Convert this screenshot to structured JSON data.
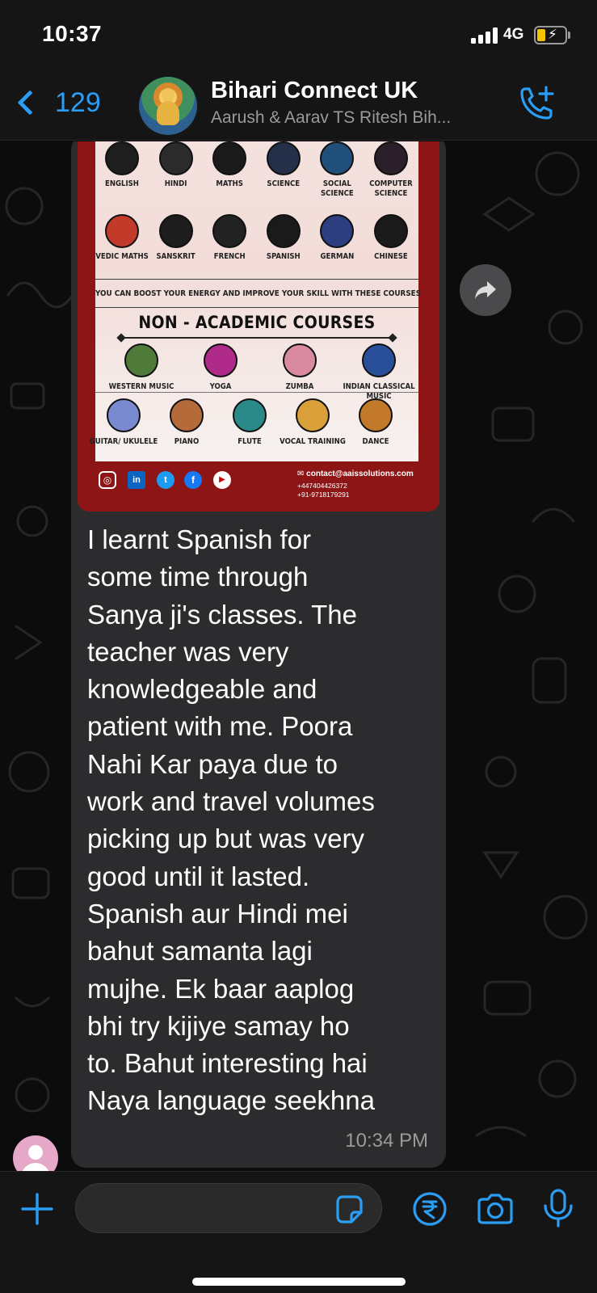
{
  "status_bar": {
    "time": "10:37",
    "network": "4G",
    "battery_color": "#f5c400"
  },
  "header": {
    "back_count": "129",
    "title": "Bihari Connect UK",
    "subtitle": "Aarush & Aarav TS Ritesh Bih..."
  },
  "poster": {
    "academic_courses": [
      "ENGLISH",
      "HINDI",
      "MATHS",
      "SCIENCE",
      "SOCIAL SCIENCE",
      "COMPUTER SCIENCE",
      "VEDIC MATHS",
      "SANSKRIT",
      "FRENCH",
      "SPANISH",
      "GERMAN",
      "CHINESE"
    ],
    "boost_text": "YOU CAN BOOST YOUR ENERGY AND IMPROVE YOUR SKILL WITH THESE COURSES",
    "non_academic_title": "NON - ACADEMIC COURSES",
    "non_academic_row1": [
      "WESTERN MUSIC",
      "YOGA",
      "ZUMBA",
      "INDIAN CLASSICAL MUSIC"
    ],
    "non_academic_row2": [
      "GUITAR/ UKULELE",
      "PIANO",
      "FLUTE",
      "VOCAL TRAINING",
      "DANCE"
    ],
    "contact_email": "contact@aaissolutions.com",
    "contact_phone_uk": "+447404426372",
    "contact_phone_in": "+91-9718179291"
  },
  "message": {
    "text": "I learnt Spanish for\nsome time through\nSanya ji's classes. The\nteacher was very\nknowledgeable and\npatient with me. Poora\nNahi Kar paya due to\nwork and travel volumes\npicking up but was very\ngood until it lasted.\nSpanish aur Hindi mei\nbahut samanta lagi\nmujhe. Ek baar aaplog\nbhi try kijiye samay ho\nto. Bahut interesting hai\nNaya language seekhna",
    "time": "10:34 PM"
  },
  "input": {
    "placeholder": ""
  },
  "colors": {
    "accent": "#2a9df4",
    "bubble": "#2c2c2e",
    "poster_frame": "#8e1515"
  }
}
